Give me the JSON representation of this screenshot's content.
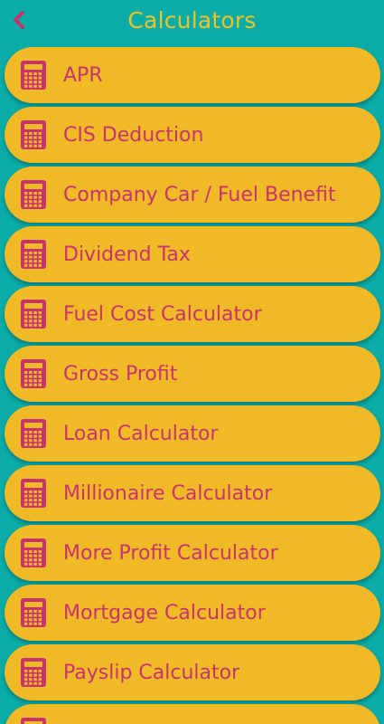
{
  "header": {
    "title": "Calculators",
    "back_icon": "chevron-left-icon"
  },
  "colors": {
    "background": "#0aaca7",
    "item_fill": "#f0ba26",
    "accent": "#c8336f",
    "title": "#f0c324"
  },
  "list": {
    "item_icon": "calculator-icon",
    "items": [
      {
        "label": "APR"
      },
      {
        "label": "CIS Deduction"
      },
      {
        "label": "Company Car / Fuel Benefit"
      },
      {
        "label": "Dividend Tax"
      },
      {
        "label": "Fuel Cost Calculator"
      },
      {
        "label": "Gross Profit"
      },
      {
        "label": "Loan Calculator"
      },
      {
        "label": "Millionaire Calculator"
      },
      {
        "label": "More Profit Calculator"
      },
      {
        "label": "Mortgage Calculator"
      },
      {
        "label": "Payslip Calculator"
      },
      {
        "label": ""
      }
    ]
  }
}
